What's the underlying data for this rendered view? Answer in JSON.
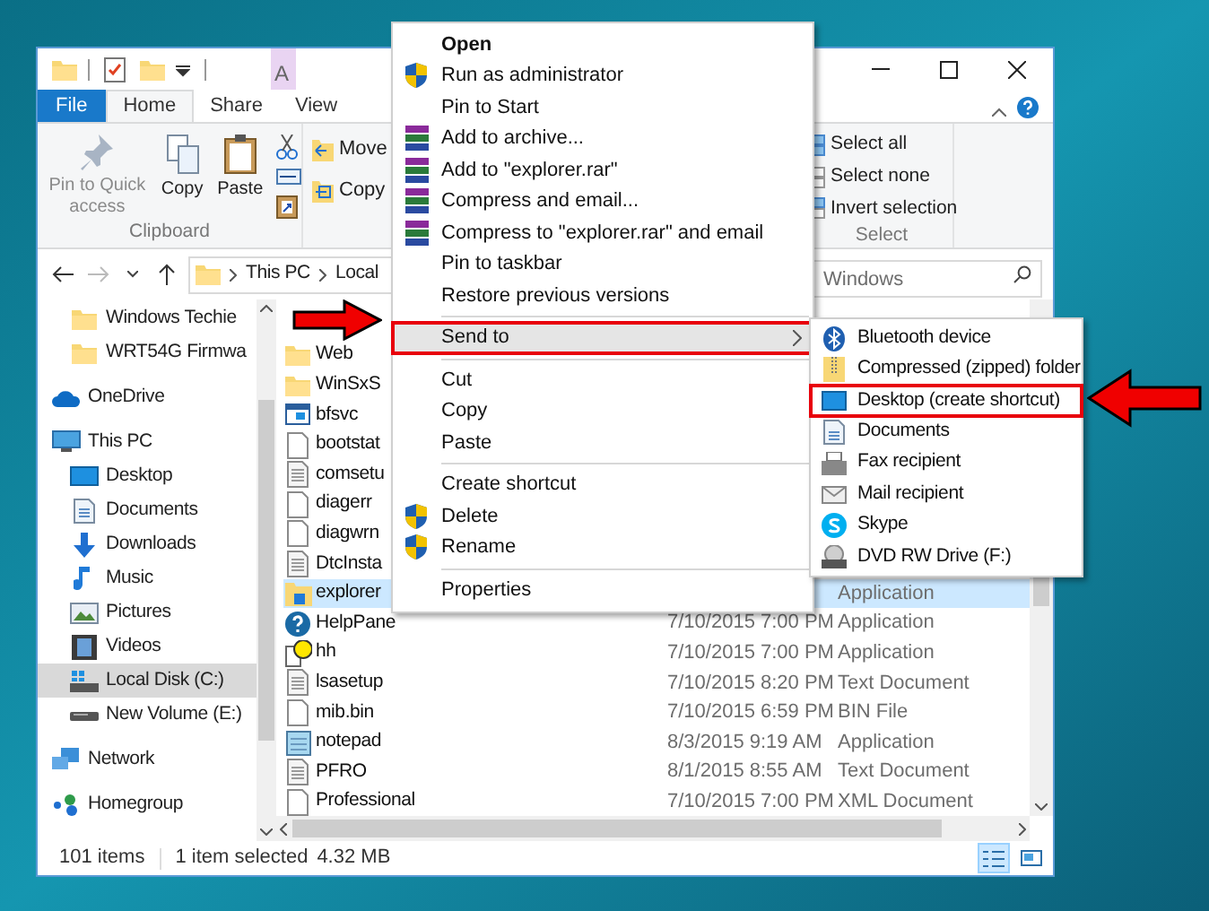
{
  "title_bar": {
    "contextual_tab": {
      "label": "A"
    }
  },
  "ribbon_tabs": [
    {
      "label": "File",
      "kind": "file",
      "selected": false
    },
    {
      "label": "Home",
      "kind": "tab",
      "selected": true
    },
    {
      "label": "Share",
      "kind": "tab",
      "selected": false
    },
    {
      "label": "View",
      "kind": "tab",
      "selected": false
    }
  ],
  "ribbon": {
    "clipboard": {
      "label": "Clipboard",
      "buttons": [
        {
          "label": "Pin to Quick access",
          "kind": "pin",
          "disabled": true
        },
        {
          "label": "Copy",
          "kind": "copy",
          "disabled": false
        },
        {
          "label": "Paste",
          "kind": "paste",
          "disabled": false
        }
      ]
    },
    "organize": {
      "buttons": [
        {
          "label": "Move",
          "kind": "move"
        },
        {
          "label": "Copy",
          "kind": "copyto"
        }
      ]
    },
    "select": {
      "label": "Select",
      "buttons": [
        {
          "label": "Select all",
          "kind": "all"
        },
        {
          "label": "Select none",
          "kind": "none"
        },
        {
          "label": "Invert selection",
          "kind": "invert"
        }
      ]
    }
  },
  "address_bar": {
    "path": [
      "This PC",
      "Local"
    ]
  },
  "search": {
    "placeholder": "Windows"
  },
  "navigation": [
    {
      "label": "Windows Techie",
      "kind": "folder",
      "selected": false
    },
    {
      "label": "WRT54G Firmwa",
      "kind": "folder",
      "selected": false
    },
    {
      "label": "OneDrive",
      "kind": "onedrive",
      "selected": false
    },
    {
      "label": "This PC",
      "kind": "pc",
      "selected": false,
      "children": [
        {
          "label": "Desktop",
          "kind": "desktop",
          "selected": false
        },
        {
          "label": "Documents",
          "kind": "documents",
          "selected": false
        },
        {
          "label": "Downloads",
          "kind": "downloads",
          "selected": false
        },
        {
          "label": "Music",
          "kind": "music",
          "selected": false
        },
        {
          "label": "Pictures",
          "kind": "pictures",
          "selected": false
        },
        {
          "label": "Videos",
          "kind": "videos",
          "selected": false
        },
        {
          "label": "Local Disk (C:)",
          "kind": "disk",
          "selected": true
        },
        {
          "label": "New Volume (E:)",
          "kind": "drive",
          "selected": false
        }
      ]
    },
    {
      "label": "Network",
      "kind": "network",
      "selected": false
    },
    {
      "label": "Homegroup",
      "kind": "homegroup",
      "selected": false
    }
  ],
  "files": [
    {
      "name": "Web",
      "kind": "folder",
      "selected": false
    },
    {
      "name": "WinSxS",
      "kind": "folder",
      "selected": false
    },
    {
      "name": "bfsvc",
      "kind": "app",
      "selected": false
    },
    {
      "name": "bootstat",
      "kind": "file",
      "selected": false
    },
    {
      "name": "comsetu",
      "kind": "text",
      "selected": false
    },
    {
      "name": "diagerr",
      "kind": "file",
      "selected": false
    },
    {
      "name": "diagwrn",
      "kind": "file",
      "selected": false
    },
    {
      "name": "DtcInsta",
      "kind": "text",
      "selected": false
    },
    {
      "name": "explorer",
      "kind": "explorer",
      "selected": true,
      "type": "Application"
    },
    {
      "name": "HelpPane",
      "kind": "help",
      "selected": false,
      "date": "7/10/2015 7:00 PM",
      "type": "Application"
    },
    {
      "name": "hh",
      "kind": "hh",
      "selected": false,
      "date": "7/10/2015 7:00 PM",
      "type": "Application"
    },
    {
      "name": "lsasetup",
      "kind": "text",
      "selected": false,
      "date": "7/10/2015 8:20 PM",
      "type": "Text Document"
    },
    {
      "name": "mib.bin",
      "kind": "file",
      "selected": false,
      "date": "7/10/2015 6:59 PM",
      "type": "BIN File"
    },
    {
      "name": "notepad",
      "kind": "notepad",
      "selected": false,
      "date": "8/3/2015 9:19 AM",
      "type": "Application"
    },
    {
      "name": "PFRO",
      "kind": "text",
      "selected": false,
      "date": "8/1/2015 8:55 AM",
      "type": "Text Document"
    },
    {
      "name": "Professional",
      "kind": "file",
      "selected": false,
      "date": "7/10/2015 7:00 PM",
      "type": "XML Document"
    }
  ],
  "status_bar": {
    "item_count": "101 items",
    "selection": "1 item selected",
    "size": "4.32 MB",
    "views": [
      {
        "kind": "details",
        "selected": true
      },
      {
        "kind": "tiles",
        "selected": false
      }
    ]
  },
  "context_menu": {
    "items": [
      {
        "kind": "plain",
        "label": "Open",
        "default": true,
        "highlighted": false,
        "outlined": false
      },
      {
        "kind": "shield",
        "label": "Run as administrator",
        "default": false,
        "highlighted": false,
        "outlined": false
      },
      {
        "kind": "plain",
        "label": "Pin to Start",
        "default": false,
        "highlighted": false,
        "outlined": false
      },
      {
        "kind": "archive",
        "label": "Add to archive...",
        "default": false,
        "highlighted": false,
        "outlined": false
      },
      {
        "kind": "archive",
        "label": "Add to \"explorer.rar\"",
        "default": false,
        "highlighted": false,
        "outlined": false
      },
      {
        "kind": "archive",
        "label": "Compress and email...",
        "default": false,
        "highlighted": false,
        "outlined": false
      },
      {
        "kind": "archive",
        "label": "Compress to \"explorer.rar\" and email",
        "default": false,
        "highlighted": false,
        "outlined": false
      },
      {
        "kind": "plain",
        "label": "Pin to taskbar",
        "default": false,
        "highlighted": false,
        "outlined": false
      },
      {
        "kind": "plain",
        "label": "Restore previous versions",
        "default": false,
        "highlighted": false,
        "outlined": false
      },
      {
        "kind": "separator"
      },
      {
        "kind": "submenu",
        "label": "Send to",
        "default": false,
        "highlighted": true,
        "outlined": true
      },
      {
        "kind": "separator"
      },
      {
        "kind": "plain",
        "label": "Cut",
        "default": false,
        "highlighted": false,
        "outlined": false
      },
      {
        "kind": "plain",
        "label": "Copy",
        "default": false,
        "highlighted": false,
        "outlined": false
      },
      {
        "kind": "plain",
        "label": "Paste",
        "default": false,
        "highlighted": false,
        "outlined": false
      },
      {
        "kind": "separator"
      },
      {
        "kind": "plain",
        "label": "Create shortcut",
        "default": false,
        "highlighted": false,
        "outlined": false
      },
      {
        "kind": "shield",
        "label": "Delete",
        "default": false,
        "highlighted": false,
        "outlined": false
      },
      {
        "kind": "shield",
        "label": "Rename",
        "default": false,
        "highlighted": false,
        "outlined": false
      },
      {
        "kind": "separator"
      },
      {
        "kind": "plain",
        "label": "Properties",
        "default": false,
        "highlighted": false,
        "outlined": false
      }
    ]
  },
  "send_to_menu": {
    "items": [
      {
        "kind": "bluetooth",
        "label": "Bluetooth device",
        "outlined": false
      },
      {
        "kind": "zip",
        "label": "Compressed (zipped) folder",
        "outlined": false
      },
      {
        "kind": "desktop",
        "label": "Desktop (create shortcut)",
        "outlined": true
      },
      {
        "kind": "documents",
        "label": "Documents",
        "outlined": false
      },
      {
        "kind": "fax",
        "label": "Fax recipient",
        "outlined": false
      },
      {
        "kind": "mail",
        "label": "Mail recipient",
        "outlined": false
      },
      {
        "kind": "skype",
        "label": "Skype",
        "outlined": false
      },
      {
        "kind": "dvd",
        "label": "DVD RW Drive (F:)",
        "outlined": false
      }
    ]
  }
}
